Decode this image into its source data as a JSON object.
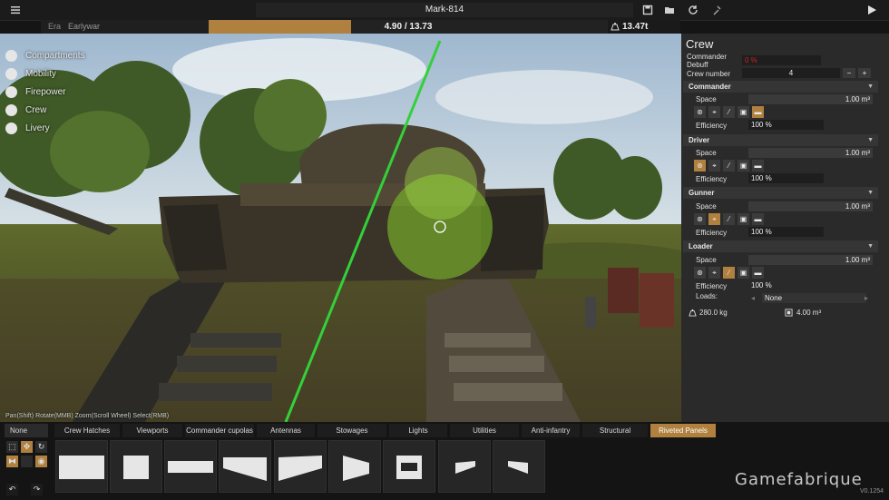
{
  "window": {
    "title": "Mark-814"
  },
  "era": {
    "label": "Era",
    "value": "Earlywar"
  },
  "weight": {
    "text": "4.90 / 13.73",
    "fill_ratio": 0.357,
    "tons": "13.47t"
  },
  "left_menu": [
    {
      "label": "Compartments",
      "icon": "box-icon"
    },
    {
      "label": "Mobility",
      "icon": "wheel-icon"
    },
    {
      "label": "Firepower",
      "icon": "gun-icon"
    },
    {
      "label": "Crew",
      "icon": "person-icon"
    },
    {
      "label": "Livery",
      "icon": "brush-icon"
    }
  ],
  "hint": "Pan(Shift) Rotate(MMB) Zoom(Scroll Wheel) Select(RMB)",
  "crew_panel": {
    "title": "Crew",
    "commander_debuff_label": "Commander Debuff",
    "commander_debuff_value": "0 %",
    "crew_number_label": "Crew number",
    "crew_number_value": "4",
    "minus": "−",
    "plus": "+",
    "sections": [
      {
        "name": "Commander",
        "space_label": "Space",
        "space": "1.00 m³",
        "efficiency_label": "Efficiency",
        "efficiency": "100 %"
      },
      {
        "name": "Driver",
        "space_label": "Space",
        "space": "1.00 m³",
        "efficiency_label": "Efficiency",
        "efficiency": "100 %"
      },
      {
        "name": "Gunner",
        "space_label": "Space",
        "space": "1.00 m³",
        "efficiency_label": "Efficiency",
        "efficiency": "100 %"
      },
      {
        "name": "Loader",
        "space_label": "Space",
        "space": "1.00 m³",
        "efficiency_label": "Efficiency",
        "efficiency": "100 %",
        "loads_label": "Loads:",
        "loads_value": "None"
      }
    ],
    "total_weight": "280.0 kg",
    "total_space": "4.00 m³"
  },
  "tabs": [
    "None",
    "Crew Hatches",
    "Viewports",
    "Commander cupolas",
    "Antennas",
    "Stowages",
    "Lights",
    "Utilities",
    "Anti-infantry",
    "Structural",
    "Riveted Panels"
  ],
  "active_tab": "Riveted Panels",
  "brand": "Gamefabrique",
  "version": "V0.1254",
  "colors": {
    "accent": "#b0803f",
    "panel": "#2a2a2a",
    "laser": "#34d03a",
    "selection": "#7fbf2a"
  }
}
